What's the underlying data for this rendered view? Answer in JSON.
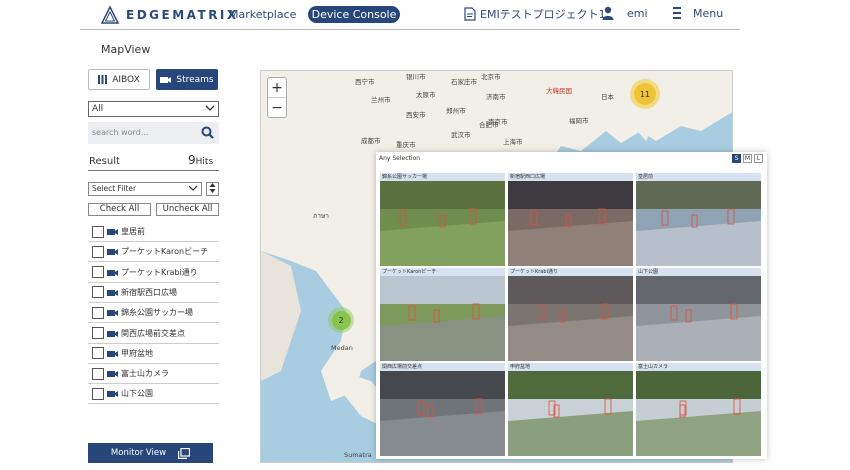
{
  "header": {
    "brand": "EDGEMATRIX",
    "nav_marketplace": "Marketplace",
    "nav_device_console": "Device Console",
    "project": "EMIテストプロジェクト1",
    "user": "emi",
    "menu": "Menu"
  },
  "page_title": "MapView",
  "sidebar": {
    "tab_aibox": "AIBOX",
    "tab_streams": "Streams",
    "filter_all": "All",
    "search_placeholder": "search word...",
    "result_label": "Result",
    "result_count": "9",
    "result_unit": "Hits",
    "select_filter": "Select Filter",
    "check_all": "Check All",
    "uncheck_all": "Uncheck All",
    "streams": [
      {
        "label": "皇居前"
      },
      {
        "label": "プーケットKaronビーチ"
      },
      {
        "label": "プーケットKrabi通り"
      },
      {
        "label": "新宿駅西口広場"
      },
      {
        "label": "錦糸公園サッカー場"
      },
      {
        "label": "関西広場前交差点"
      },
      {
        "label": "甲府盆地"
      },
      {
        "label": "富士山カメラ"
      },
      {
        "label": "山下公園"
      }
    ],
    "monitor_view": "Monitor View"
  },
  "map": {
    "zoom_in": "+",
    "zoom_out": "−",
    "labels": [
      {
        "text": "西宁市"
      },
      {
        "text": "兰州市"
      },
      {
        "text": "银川市"
      },
      {
        "text": "北京市"
      },
      {
        "text": "石家庄市"
      },
      {
        "text": "太原市"
      },
      {
        "text": "济南市"
      },
      {
        "text": "郑州市"
      },
      {
        "text": "西安市"
      },
      {
        "text": "南京市"
      },
      {
        "text": "合肥市"
      },
      {
        "text": "武汉市"
      },
      {
        "text": "上海市"
      },
      {
        "text": "成都市"
      },
      {
        "text": "重庆市"
      },
      {
        "text": "大韓民国"
      },
      {
        "text": "福岡市"
      },
      {
        "text": "日本"
      },
      {
        "text": "ภาษา"
      },
      {
        "text": "Medan"
      },
      {
        "text": "Sumatra"
      }
    ],
    "clusters": [
      {
        "count": "11"
      },
      {
        "count": "2"
      }
    ]
  },
  "selection_panel": {
    "title": "Any Selection",
    "sizes": [
      "S",
      "M",
      "L"
    ],
    "active_size": "S",
    "tiles": [
      {
        "title": "錦糸公園サッカー場"
      },
      {
        "title": "新宿駅西口広場"
      },
      {
        "title": "皇居前"
      },
      {
        "title": "プーケットKaronビーチ"
      },
      {
        "title": "プーケットKrabi通り"
      },
      {
        "title": "山下公園"
      },
      {
        "title": "関西広場前交差点"
      },
      {
        "title": "甲府盆地"
      },
      {
        "title": "富士山カメラ"
      }
    ]
  },
  "colors": {
    "primary": "#27477a",
    "map_water": "#a9cde0",
    "map_land": "#f2efe9",
    "cluster_yellow": "#f0be28",
    "cluster_green": "#82c346"
  }
}
